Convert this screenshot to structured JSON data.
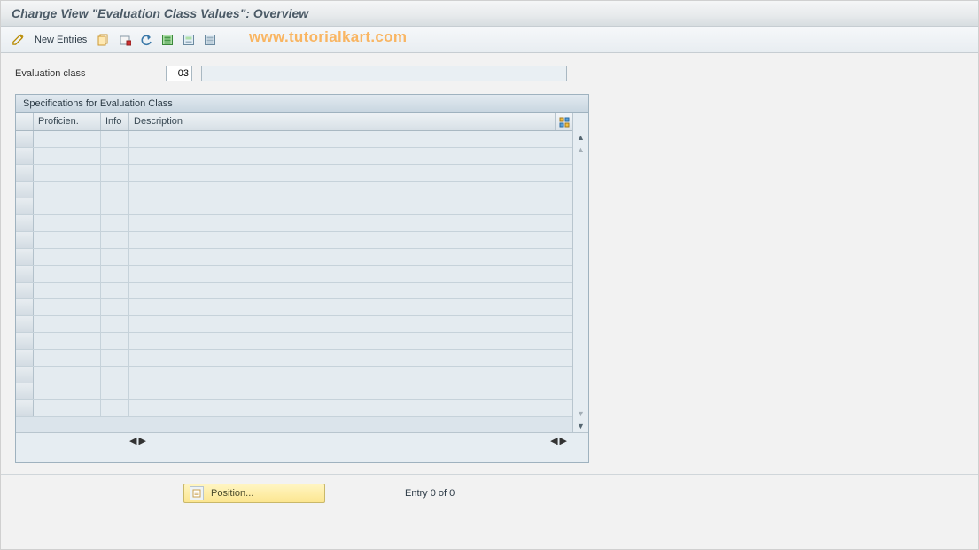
{
  "title": "Change View \"Evaluation Class Values\": Overview",
  "toolbar": {
    "new_entries": "New Entries"
  },
  "watermark": "www.tutorialkart.com",
  "field": {
    "label": "Evaluation class",
    "value": "03",
    "description": ""
  },
  "table": {
    "title": "Specifications for Evaluation Class",
    "columns": {
      "proficien": "Proficien.",
      "info": "Info",
      "description": "Description"
    },
    "row_count": 17
  },
  "footer": {
    "position_label": "Position...",
    "entry_text": "Entry 0 of 0"
  }
}
